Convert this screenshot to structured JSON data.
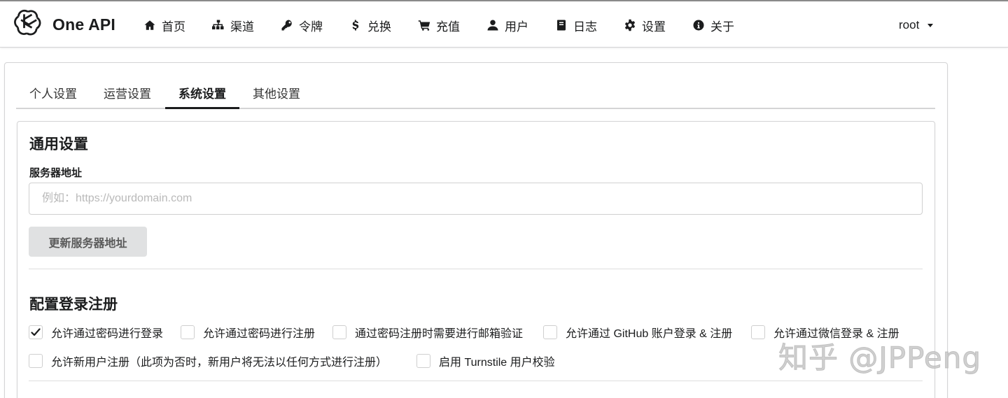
{
  "app": {
    "name": "One API",
    "logo": "openai-logo-icon"
  },
  "nav": {
    "items": [
      {
        "label": "首页",
        "icon": "home-icon"
      },
      {
        "label": "渠道",
        "icon": "sitemap-icon"
      },
      {
        "label": "令牌",
        "icon": "key-icon"
      },
      {
        "label": "兑换",
        "icon": "dollar-icon"
      },
      {
        "label": "充值",
        "icon": "cart-icon"
      },
      {
        "label": "用户",
        "icon": "user-icon"
      },
      {
        "label": "日志",
        "icon": "book-icon"
      },
      {
        "label": "设置",
        "icon": "gear-icon"
      },
      {
        "label": "关于",
        "icon": "info-circle-icon"
      }
    ],
    "user": "root"
  },
  "tabs": [
    "个人设置",
    "运营设置",
    "系统设置",
    "其他设置"
  ],
  "active_tab": "系统设置",
  "general": {
    "title": "通用设置",
    "server_label": "服务器地址",
    "server_placeholder": "例如：https://yourdomain.com",
    "server_value": "",
    "update_button": "更新服务器地址"
  },
  "login": {
    "title": "配置登录注册",
    "options": [
      {
        "label": "允许通过密码进行登录",
        "checked": true
      },
      {
        "label": "允许通过密码进行注册",
        "checked": false
      },
      {
        "label": "通过密码注册时需要进行邮箱验证",
        "checked": false
      },
      {
        "label": "允许通过 GitHub 账户登录 & 注册",
        "checked": false
      },
      {
        "label": "允许通过微信登录 & 注册",
        "checked": false
      },
      {
        "label": "允许新用户注册（此项为否时，新用户将无法以任何方式进行注册）",
        "checked": false
      },
      {
        "label": "启用 Turnstile 用户校验",
        "checked": false
      }
    ]
  },
  "watermark": "知乎 @JPPeng"
}
